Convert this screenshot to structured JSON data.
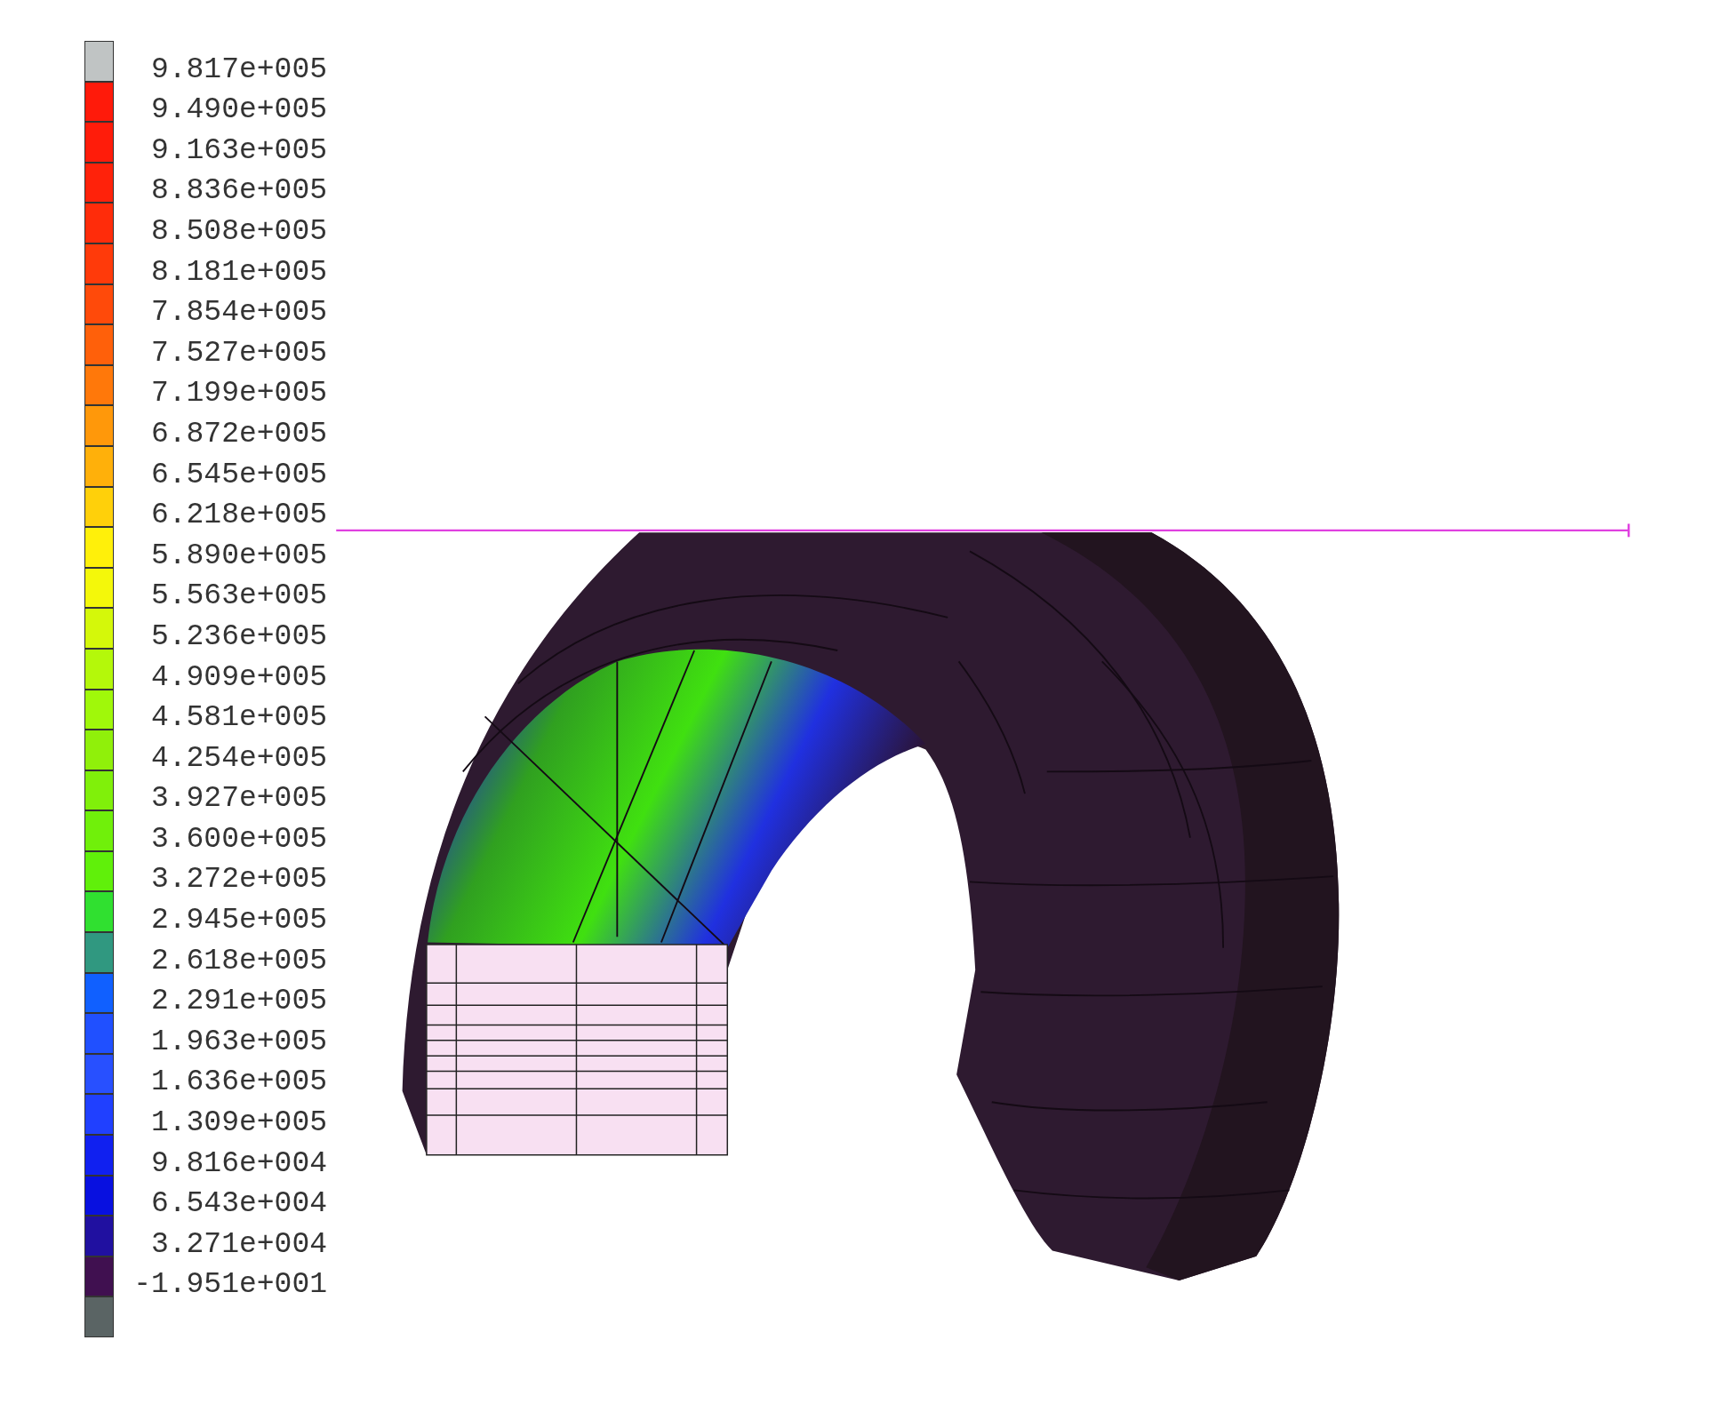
{
  "legend": {
    "entries": [
      {
        "label": "9.817e+005",
        "color": "#c0c4c4"
      },
      {
        "label": "9.490e+005",
        "color": "#ff1a0a"
      },
      {
        "label": "9.163e+005",
        "color": "#ff1c0a"
      },
      {
        "label": "8.836e+005",
        "color": "#ff220a"
      },
      {
        "label": "8.508e+005",
        "color": "#ff2c0a"
      },
      {
        "label": "8.181e+005",
        "color": "#ff3a0a"
      },
      {
        "label": "7.854e+005",
        "color": "#ff4a0a"
      },
      {
        "label": "7.527e+005",
        "color": "#ff600a"
      },
      {
        "label": "7.199e+005",
        "color": "#ff780a"
      },
      {
        "label": "6.872e+005",
        "color": "#ff980a"
      },
      {
        "label": "6.545e+005",
        "color": "#ffb00a"
      },
      {
        "label": "6.218e+005",
        "color": "#ffd00a"
      },
      {
        "label": "5.890e+005",
        "color": "#fff00a"
      },
      {
        "label": "5.563e+005",
        "color": "#f4f80a"
      },
      {
        "label": "5.236e+005",
        "color": "#d4f80a"
      },
      {
        "label": "4.909e+005",
        "color": "#b4f80a"
      },
      {
        "label": "4.581e+005",
        "color": "#a0f80a"
      },
      {
        "label": "4.254e+005",
        "color": "#90f00a"
      },
      {
        "label": "3.927e+005",
        "color": "#80f00a"
      },
      {
        "label": "3.600e+005",
        "color": "#70f00a"
      },
      {
        "label": "3.272e+005",
        "color": "#60f00a"
      },
      {
        "label": "2.945e+005",
        "color": "#30e030"
      },
      {
        "label": "2.618e+005",
        "color": "#309880"
      },
      {
        "label": "2.291e+005",
        "color": "#1060ff"
      },
      {
        "label": "1.963e+005",
        "color": "#2050ff"
      },
      {
        "label": "1.636e+005",
        "color": "#2850ff"
      },
      {
        "label": "1.309e+005",
        "color": "#2040ff"
      },
      {
        "label": "9.816e+004",
        "color": "#1020f0"
      },
      {
        "label": "6.543e+004",
        "color": "#0810e0"
      },
      {
        "label": "3.271e+004",
        "color": "#2010a0"
      },
      {
        "label": "-1.951e+001",
        "color": "#401050"
      },
      {
        "color": "#5a6464"
      }
    ]
  }
}
